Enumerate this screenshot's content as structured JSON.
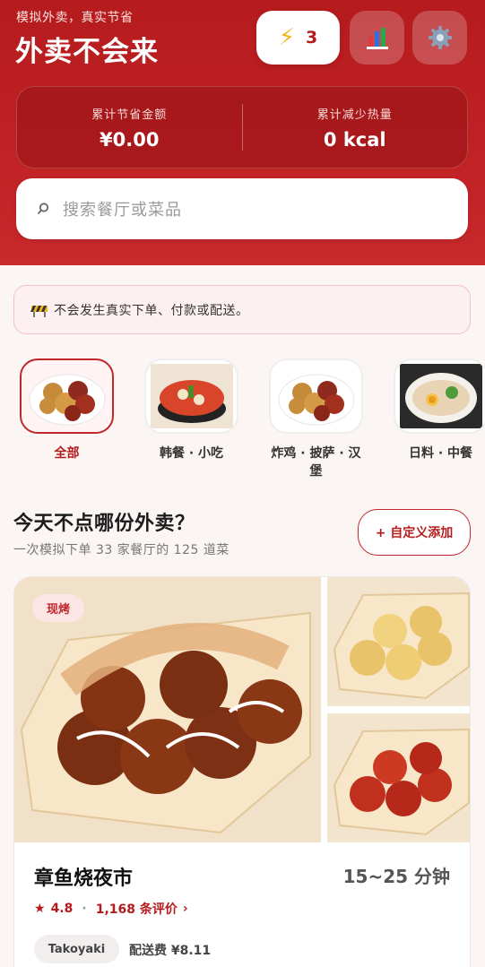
{
  "header": {
    "tagline": "模拟外卖，真实节省",
    "title": "外卖不会来",
    "streak_count": "3",
    "streak_icon": "lightning-icon",
    "stats_icon": "bar-chart-icon",
    "settings_icon": "gear-icon"
  },
  "stats": {
    "saved_label": "累计节省金额",
    "saved_value": "¥0.00",
    "calories_label": "累计减少热量",
    "calories_value": "0 kcal"
  },
  "search": {
    "placeholder": "搜索餐厅或菜品"
  },
  "notice": {
    "text": "不会发生真实下单、付款或配送。"
  },
  "categories": [
    {
      "label": "全部",
      "active": true,
      "food": "fried-chicken"
    },
    {
      "label": "韩餐 · 小吃",
      "active": false,
      "food": "kimchi-stew"
    },
    {
      "label": "炸鸡 · 披萨 · 汉堡",
      "active": false,
      "food": "fried-chicken"
    },
    {
      "label": "日料 · 中餐",
      "active": false,
      "food": "ramen"
    }
  ],
  "section": {
    "title": "今天不点哪份外卖？",
    "subtitle": "一次模拟下单 33 家餐厅的 125 道菜",
    "custom_add_label": "+ 自定义添加"
  },
  "restaurant": {
    "badge": "现烤",
    "name": "章鱼烧夜市",
    "eta": "15~25 分钟",
    "rating": "4.8",
    "reviews": "1,168 条评价",
    "cuisine": "Takoyaki",
    "delivery_fee": "配送费 ¥8.11"
  },
  "colors": {
    "brand_red": "#b51b1d",
    "accent_yellow": "#f2b51c"
  }
}
